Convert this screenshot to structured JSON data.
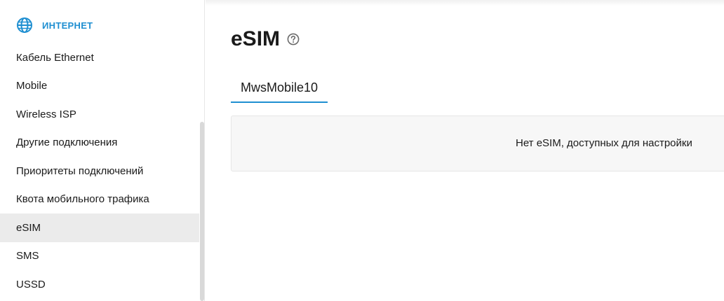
{
  "colors": {
    "accent": "#1f8fd1",
    "active_item_bg": "#ebebeb",
    "panel_bg": "#f7f7f7"
  },
  "sidebar": {
    "section": {
      "title": "ИНТЕРНЕТ",
      "icon": "globe-icon"
    },
    "items": [
      {
        "label": "Кабель Ethernet",
        "active": false
      },
      {
        "label": "Mobile",
        "active": false
      },
      {
        "label": "Wireless ISP",
        "active": false
      },
      {
        "label": "Другие подключения",
        "active": false
      },
      {
        "label": "Приоритеты подключений",
        "active": false
      },
      {
        "label": "Квота мобильного трафика",
        "active": false
      },
      {
        "label": "eSIM",
        "active": true
      },
      {
        "label": "SMS",
        "active": false
      },
      {
        "label": "USSD",
        "active": false
      }
    ]
  },
  "main": {
    "title": "eSIM",
    "help_icon": "help-circle-icon",
    "tabs": [
      {
        "label": "MwsMobile10",
        "active": true
      }
    ],
    "empty_message": "Нет eSIM, доступных для настройки"
  }
}
